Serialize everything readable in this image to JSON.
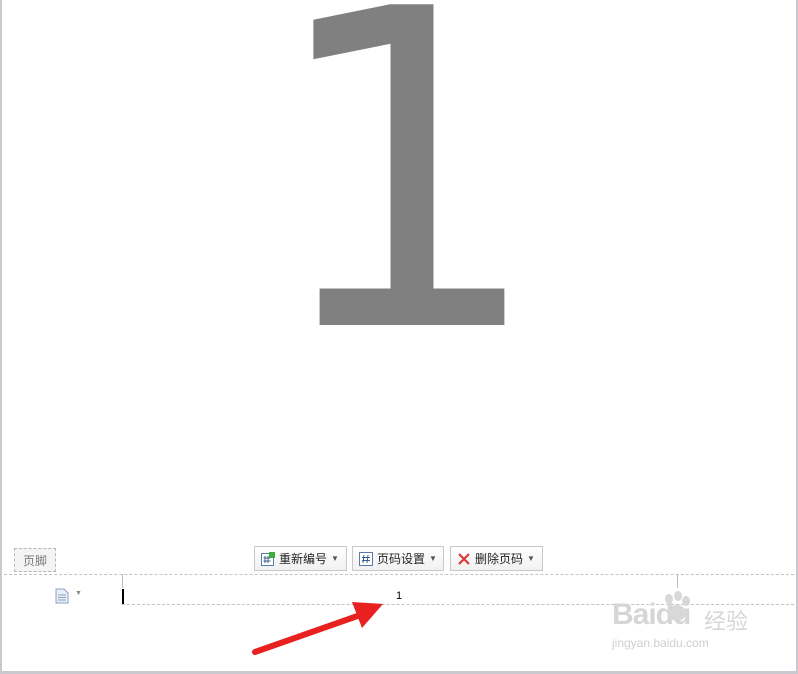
{
  "page": {
    "big_number": "1"
  },
  "footer": {
    "label": "页脚",
    "toolbar": {
      "renumber_label": "重新编号",
      "page_settings_label": "页码设置",
      "delete_page_number_label": "删除页码"
    },
    "page_number_value": "1"
  },
  "annotation": {
    "arrow_color": "#e82020"
  },
  "watermark": {
    "logo_text": "Baidu",
    "service_text": "经验",
    "url": "jingyan.baidu.com"
  },
  "icons": {
    "renumber": "renumber-icon",
    "page_settings": "page-settings-icon",
    "delete": "delete-x-icon",
    "document": "document-icon"
  }
}
